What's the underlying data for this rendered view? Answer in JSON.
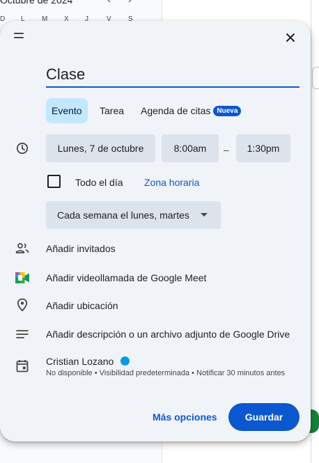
{
  "background": {
    "month_label": "Octubre de 2024",
    "nav_prev": "‹",
    "nav_next": "›",
    "weekdays": [
      "D",
      "L",
      "M",
      "X",
      "J",
      "V",
      "S"
    ]
  },
  "dialog": {
    "title_value": "Clase",
    "tabs": [
      {
        "label": "Evento",
        "active": true
      },
      {
        "label": "Tarea",
        "active": false
      },
      {
        "label": "Agenda de citas",
        "active": false,
        "badge": "Nueva"
      }
    ],
    "date": "Lunes, 7 de octubre",
    "start_time": "8:00am",
    "separator": "–",
    "end_time": "1:30pm",
    "all_day_label": "Todo el día",
    "all_day_checked": false,
    "timezone_link": "Zona horaria",
    "recurrence": "Cada semana el lunes, martes",
    "add_guests": "Añadir invitados",
    "add_meet": "Añadir videollamada de Google Meet",
    "add_location": "Añadir ubicación",
    "add_description": "Añadir descripción o un archivo adjunto de Google Drive",
    "owner": {
      "name": "Cristian Lozano",
      "calendar_color": "#039be5",
      "detail": "No disponible • Visibilidad predeterminada • Notificar 30 minutos antes"
    },
    "more_options": "Más opciones",
    "save": "Guardar"
  },
  "icons": {
    "drag": "drag-handle-icon",
    "close": "close-icon",
    "time": "clock-icon",
    "guests": "people-icon",
    "meet": "google-meet-icon",
    "location": "location-pin-icon",
    "description": "notes-icon",
    "calendar": "calendar-icon"
  },
  "colors": {
    "accent": "#0b57d0",
    "tab_active": "#c2e7ff",
    "dialog_bg": "#f0f4f9",
    "field_bg": "#dde3ea"
  }
}
